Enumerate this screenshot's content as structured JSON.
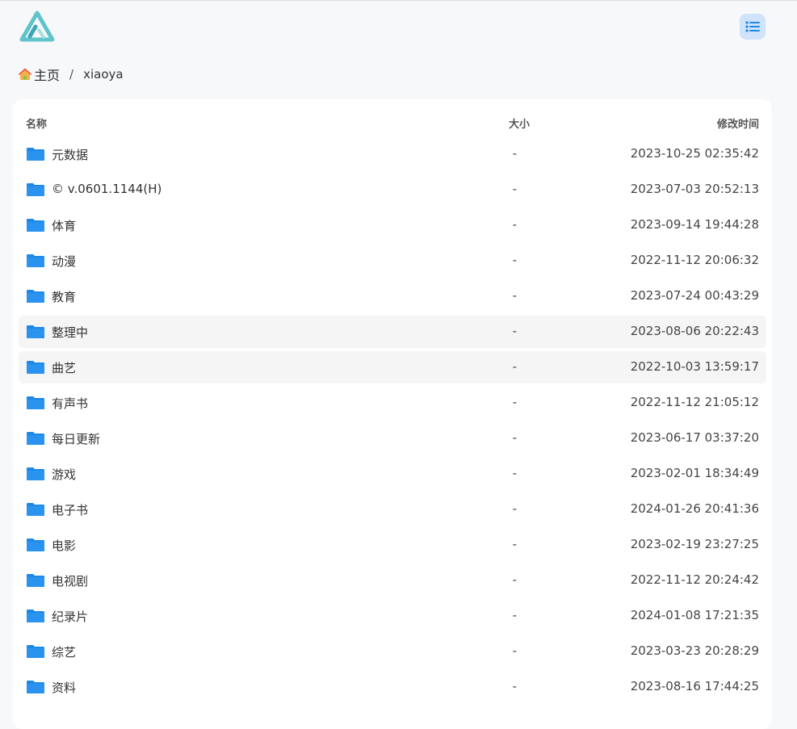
{
  "header": {
    "logo_icon": "triangle-logo-icon",
    "layout_toggle_icon": "list-icon"
  },
  "breadcrumb": {
    "home_icon": "home-icon",
    "home_label": "主页",
    "separator": "/",
    "current": "xiaoya"
  },
  "table": {
    "columns": {
      "name": "名称",
      "size": "大小",
      "modified": "修改时间"
    },
    "rows": [
      {
        "name": "元数据",
        "size": "-",
        "modified": "2023-10-25 02:35:42"
      },
      {
        "name": "© v.0601.1144(H)",
        "size": "-",
        "modified": "2023-07-03 20:52:13"
      },
      {
        "name": "体育",
        "size": "-",
        "modified": "2023-09-14 19:44:28"
      },
      {
        "name": "动漫",
        "size": "-",
        "modified": "2022-11-12 20:06:32"
      },
      {
        "name": "教育",
        "size": "-",
        "modified": "2023-07-24 00:43:29"
      },
      {
        "name": "整理中",
        "size": "-",
        "modified": "2023-08-06 20:22:43"
      },
      {
        "name": "曲艺",
        "size": "-",
        "modified": "2022-10-03 13:59:17"
      },
      {
        "name": "有声书",
        "size": "-",
        "modified": "2022-11-12 21:05:12"
      },
      {
        "name": "每日更新",
        "size": "-",
        "modified": "2023-06-17 03:37:20"
      },
      {
        "name": "游戏",
        "size": "-",
        "modified": "2023-02-01 18:34:49"
      },
      {
        "name": "电子书",
        "size": "-",
        "modified": "2024-01-26 20:41:36"
      },
      {
        "name": "电影",
        "size": "-",
        "modified": "2023-02-19 23:27:25"
      },
      {
        "name": "电视剧",
        "size": "-",
        "modified": "2022-11-12 20:24:42"
      },
      {
        "name": "纪录片",
        "size": "-",
        "modified": "2024-01-08 17:21:35"
      },
      {
        "name": "综艺",
        "size": "-",
        "modified": "2023-03-23 20:28:29"
      },
      {
        "name": "资料",
        "size": "-",
        "modified": "2023-08-16 17:44:25"
      }
    ]
  },
  "colors": {
    "accent": "#1e88e5",
    "logo": "#5ec4c9",
    "toggle_bg": "#cfe3fb",
    "page_bg": "#f7f8fa",
    "row_hover": "#f5f5f5"
  }
}
